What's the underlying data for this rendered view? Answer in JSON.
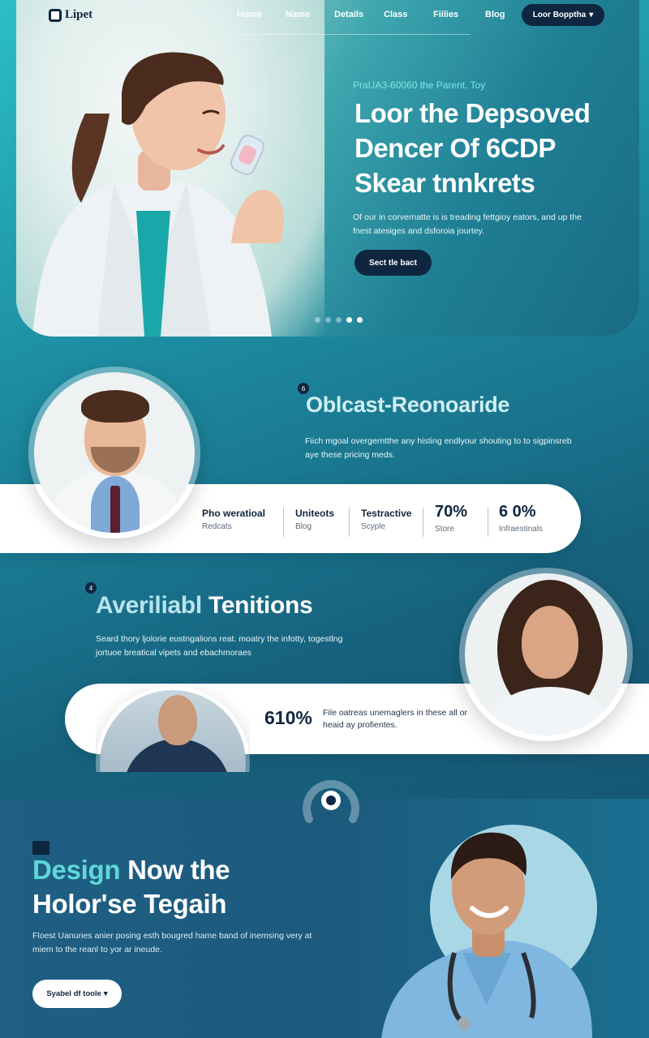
{
  "nav": {
    "logo_text": "Lipet",
    "links": [
      "Home",
      "Name",
      "Details",
      "Class",
      "Fiilies",
      "Blog"
    ],
    "cta_label": "Loor Bopptha",
    "cta_icon": "chevron-down-icon"
  },
  "hero": {
    "eyebrow": "PraUA3-60060 the Parent. Toy",
    "title_lines": [
      "Loor the Depsoved",
      "Dencer Of 6CDP",
      "Skear tnnkrets"
    ],
    "description": "Of our in corvernatte is is treading fettgioy eators, and up the fnest atesiges and dsforoia jourtey.",
    "button_label": "Sect tle bact",
    "slide_count": 5,
    "active_slides": [
      3,
      4
    ]
  },
  "section2": {
    "badge": "6",
    "title": "Oblcast-Reonoaride",
    "description": "Fiich mgoal overgerntthe any histing endlyour shouting to to sigpinsreb aye these pricing meds.",
    "stats": [
      {
        "value": "Pho weratioal",
        "label": "Redcats"
      },
      {
        "value": "Uniteots",
        "label": "Blog"
      },
      {
        "value": "Testractive",
        "label": "Scyple"
      },
      {
        "value": "70%",
        "label": "Store"
      },
      {
        "value": "6 0%",
        "label": "Infraestinals"
      }
    ]
  },
  "section3": {
    "badge": "4",
    "title_part1": "Averiliabl",
    "title_part2": "Tenitions",
    "description": "Seard thory ljolorie eustngalions reat. moatry the infotty, togestlng jortuoe breatical vipets and ebachmoraes",
    "card_value": "610%",
    "card_text": "File oatreas unemaglers in these all or heaid ay profientes."
  },
  "section4": {
    "title_accent": "Design",
    "title_rest": "Now the",
    "title_line2": "Holor'se Tegaih",
    "description": "Floest Uanuries anier posing esth bougred hame band of inemsing very at miem to the reanl to yor ar ineude.",
    "button_label": "Syabel df toole",
    "button_icon": "chevron-down-icon"
  },
  "colors": {
    "navy": "#0f2640",
    "teal": "#2bbfc7",
    "accent_cyan": "#5fd8d8",
    "white": "#ffffff"
  }
}
